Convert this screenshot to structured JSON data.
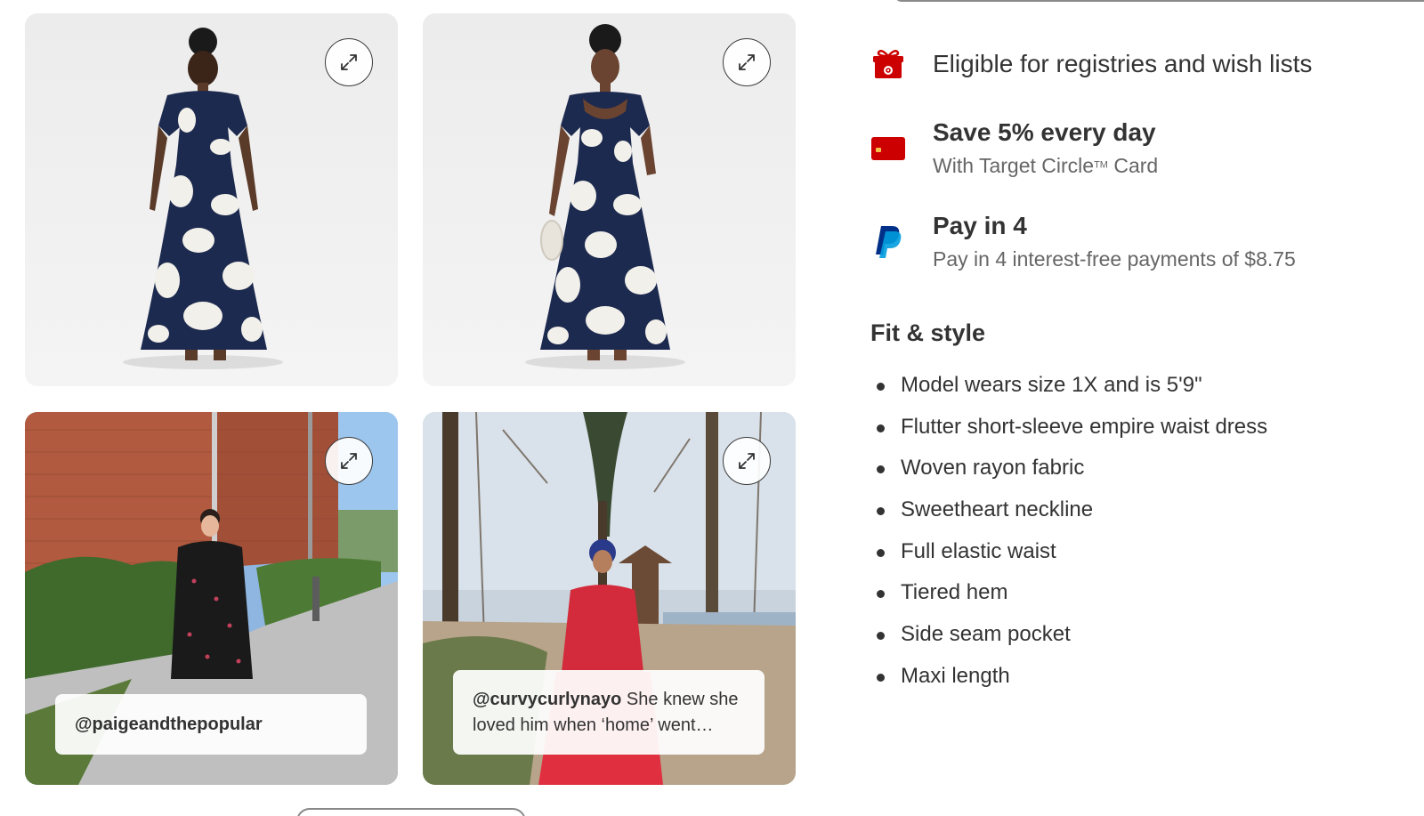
{
  "gallery": {
    "tiles": [
      {
        "id": "back-view",
        "expand_icon": "expand-arrows-icon"
      },
      {
        "id": "front-view",
        "expand_icon": "expand-arrows-icon"
      },
      {
        "id": "ugc-paige",
        "expand_icon": "expand-arrows-icon",
        "caption_handle": "@paigeandthepopular",
        "caption_text": ""
      },
      {
        "id": "ugc-curvy",
        "expand_icon": "expand-arrows-icon",
        "caption_handle": "@curvycurlynayo",
        "caption_text": "She knew she loved him when ‘home’ went…"
      }
    ]
  },
  "perks": {
    "registry": {
      "icon": "gift-icon",
      "label": "Eligible for registries and wish lists"
    },
    "circle_card": {
      "icon": "credit-card-icon",
      "title": "Save 5% every day",
      "subtitle_pre": "With Target Circle",
      "subtitle_tm": "TM",
      "subtitle_post": " Card"
    },
    "pay_in_4": {
      "icon": "paypal-icon",
      "title": "Pay in 4",
      "subtitle": "Pay in 4 interest-free payments of $8.75"
    }
  },
  "fit_style": {
    "title": "Fit & style",
    "items": [
      "Model wears size 1X and is 5'9\"",
      "Flutter short-sleeve empire waist dress",
      "Woven rayon fabric",
      "Sweetheart neckline",
      "Full elastic waist",
      "Tiered hem",
      "Side seam pocket",
      "Maxi length"
    ]
  },
  "colors": {
    "brand_red": "#cc0000",
    "paypal_dark": "#003087",
    "paypal_light": "#009cde",
    "dress_navy": "#1d2a4f",
    "text": "#333333",
    "muted": "#666666"
  }
}
